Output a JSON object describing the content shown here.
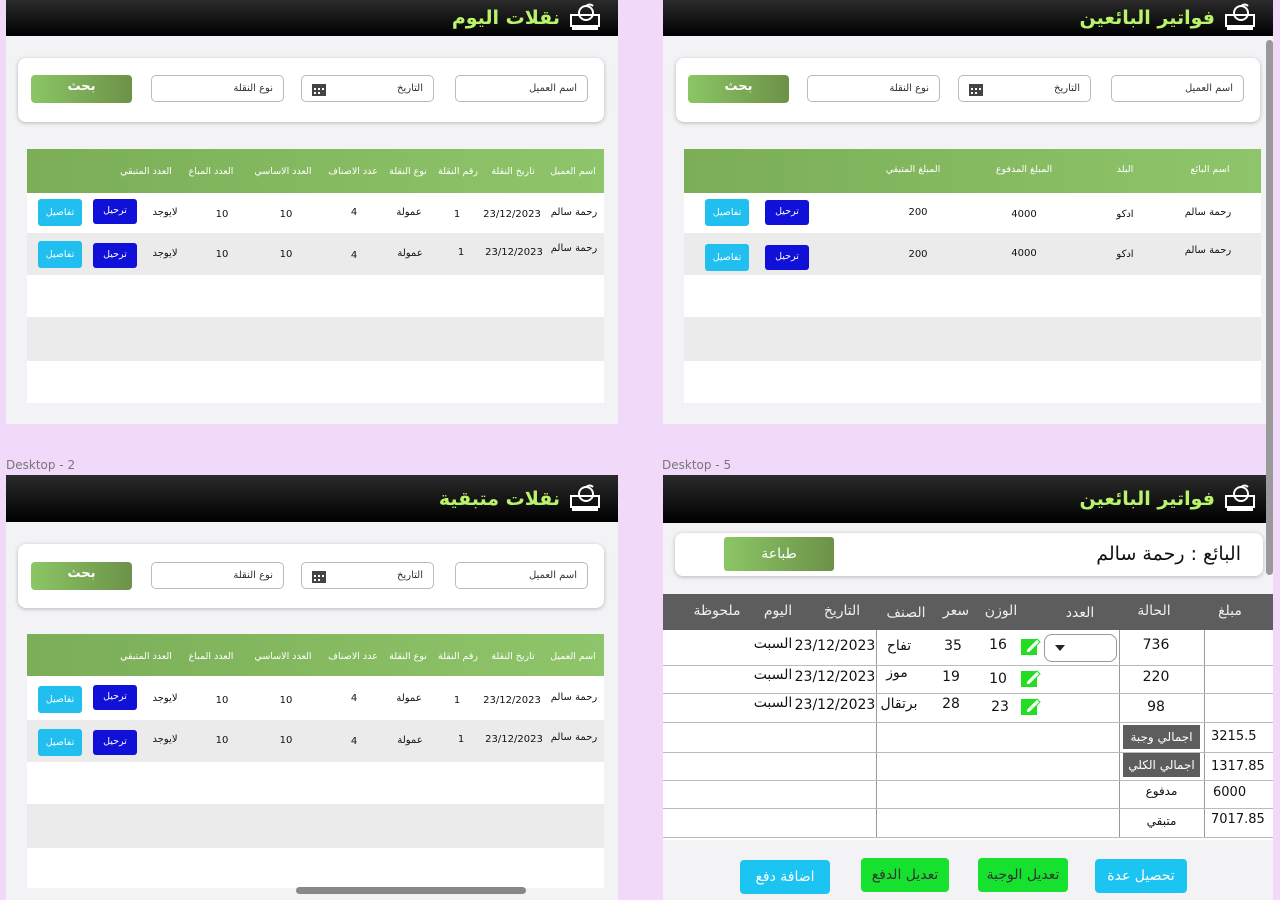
{
  "frames": {
    "today_transfers": {
      "title": "نقلات اليوم",
      "search": {
        "customer": "اسم العميل",
        "date": "التاريخ",
        "type": "نوع النقلة",
        "button": "بحث"
      },
      "columns": [
        "اسم العميل",
        "تاريخ النقلة",
        "رقم النقلة",
        "نوع النقلة",
        "عدد الاصناف",
        "العدد الاساسي",
        "العدد المباع",
        "العدد المتبقي"
      ],
      "rows": [
        {
          "customer": "رحمة سالم",
          "date": "23/12/2023",
          "number": "1",
          "type": "عمولة",
          "items": "4",
          "base": "10",
          "sold": "10",
          "remaining": "لايوجد"
        },
        {
          "customer": "رحمة سالم",
          "date": "23/12/2023",
          "number": "1",
          "type": "عمولة",
          "items": "4",
          "base": "10",
          "sold": "10",
          "remaining": "لايوجد"
        }
      ],
      "actions": {
        "post": "ترحيل",
        "details": "تفاصيل"
      }
    },
    "seller_invoices": {
      "title": "فواتير البائعين",
      "search": {
        "customer": "اسم العميل",
        "date": "التاريخ",
        "type": "نوع النقلة",
        "button": "بحث"
      },
      "columns": [
        "اسم البائع",
        "البلد",
        "المبلغ المدفوع",
        "المبلغ المتبقي"
      ],
      "rows": [
        {
          "seller": "رحمة سالم",
          "country": "ادكو",
          "paid": "4000",
          "remaining": "200"
        },
        {
          "seller": "رحمة سالم",
          "country": "ادكو",
          "paid": "4000",
          "remaining": "200"
        }
      ],
      "actions": {
        "post": "ترحيل",
        "details": "تفاصيل"
      }
    },
    "remaining_transfers": {
      "label": "Desktop - 2",
      "title": "نقلات متبقية",
      "search": {
        "customer": "اسم العميل",
        "date": "التاريخ",
        "type": "نوع النقلة",
        "button": "بحث"
      },
      "columns": [
        "اسم العميل",
        "تاريخ النقلة",
        "رقم النقلة",
        "نوع النقلة",
        "عدد الاصناف",
        "العدد الاساسي",
        "العدد المباع",
        "العدد المتبقي"
      ],
      "rows": [
        {
          "customer": "رحمة سالم",
          "date": "23/12/2023",
          "number": "1",
          "type": "عمولة",
          "items": "4",
          "base": "10",
          "sold": "10",
          "remaining": "لايوجد"
        },
        {
          "customer": "رحمة سالم",
          "date": "23/12/2023",
          "number": "1",
          "type": "عمولة",
          "items": "4",
          "base": "10",
          "sold": "10",
          "remaining": "لايوجد"
        }
      ],
      "actions": {
        "post": "ترحيل",
        "details": "تفاصيل"
      }
    },
    "invoice_detail": {
      "label": "Desktop - 5",
      "title": "فواتير البائعين",
      "seller": "البائع : رحمة سالم",
      "print": "طباعة",
      "columns": [
        "مبلغ",
        "الحالة",
        "العدد",
        "الوزن",
        "سعر",
        "الصنف",
        "التاريخ",
        "اليوم",
        "ملحوظة"
      ],
      "rows": [
        {
          "state": "736",
          "weight": "16",
          "price": "35",
          "item": "تفاح",
          "date": "23/12/2023",
          "day": "السبت"
        },
        {
          "state": "220",
          "weight": "10",
          "price": "19",
          "item": "موز",
          "date": "23/12/2023",
          "day": "السبت"
        },
        {
          "state": "98",
          "weight": "23",
          "price": "28",
          "item": "برتقال",
          "date": "23/12/2023",
          "day": "السبت"
        }
      ],
      "summary": [
        {
          "label": "اجمالي وجبة",
          "value": "3215.5"
        },
        {
          "label": "اجمالي الكلي",
          "value": "1317.85"
        },
        {
          "label": "مدفوع",
          "value": "6000"
        },
        {
          "label": "متبقي",
          "value": "7017.85"
        }
      ],
      "buttons": {
        "collect": "تحصيل عدة",
        "edit_meal": "تعديل الوجبة",
        "edit_payment": "تعديل الدفع",
        "add_payment": "اضافة دفع"
      }
    }
  },
  "colors": {
    "accent_green": "#8bc665",
    "title_green": "#b9f36c",
    "blue": "#1010d8",
    "cyan": "#20bff0",
    "bright_green": "#16e12e"
  }
}
